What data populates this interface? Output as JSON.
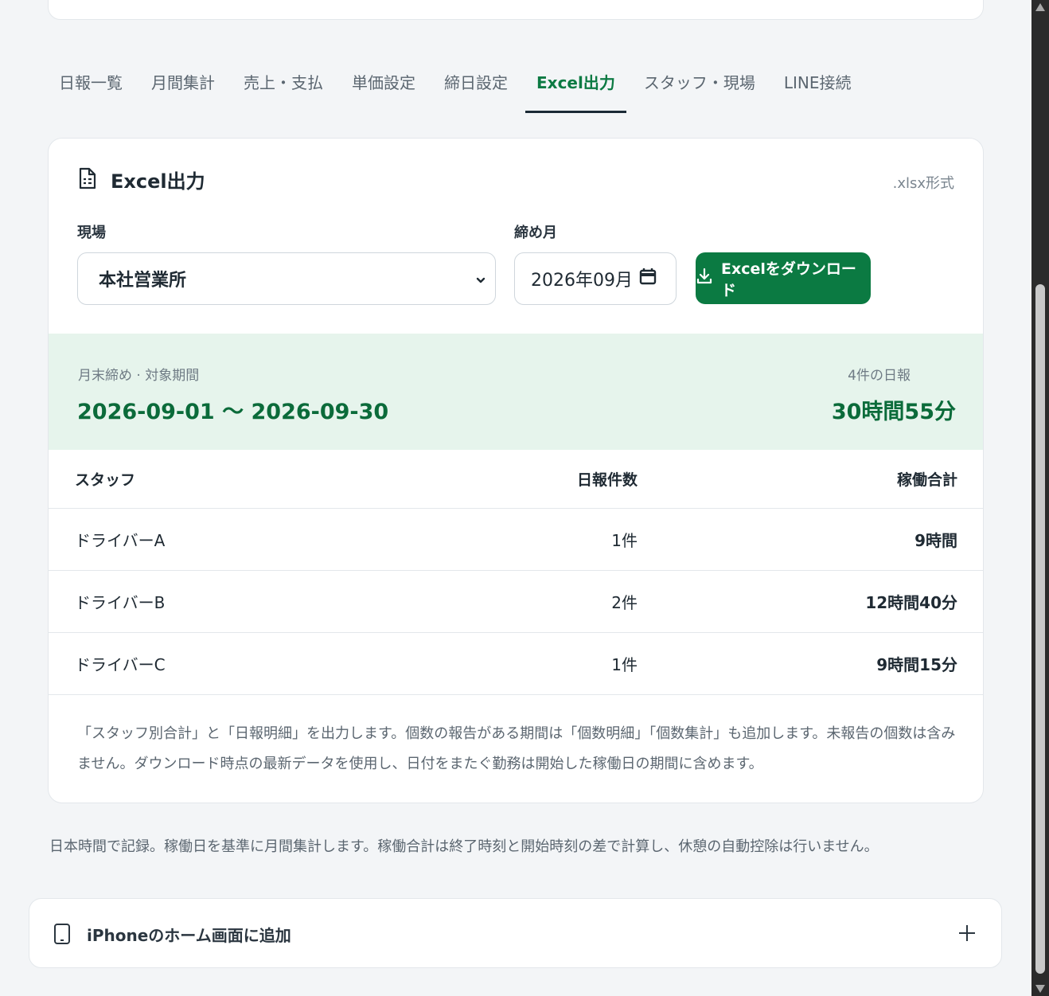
{
  "tabs": [
    {
      "label": "日報一覧"
    },
    {
      "label": "月間集計"
    },
    {
      "label": "売上・支払"
    },
    {
      "label": "単価設定"
    },
    {
      "label": "締日設定"
    },
    {
      "label": "Excel出力",
      "active": true
    },
    {
      "label": "スタッフ・現場"
    },
    {
      "label": "LINE接続"
    }
  ],
  "export_card": {
    "title": "Excel出力",
    "format": ".xlsx形式",
    "site_label": "現場",
    "site_value": "本社営業所",
    "month_label": "締め月",
    "month_value": "2026年09月",
    "download_label": "Excelをダウンロード",
    "icons": {
      "title": "document-icon",
      "select": "chevron-down-icon",
      "date": "calendar-icon",
      "download": "download-icon"
    }
  },
  "summary": {
    "period_label": "月末締め · 対象期間",
    "period_value": "2026-09-01 〜 2026-09-30",
    "count_label": "4件の日報",
    "total_value": "30時間55分"
  },
  "table": {
    "headers": [
      "スタッフ",
      "日報件数",
      "稼働合計"
    ],
    "rows": [
      [
        "ドライバーA",
        "1件",
        "9時間"
      ],
      [
        "ドライバーB",
        "2件",
        "12時間40分"
      ],
      [
        "ドライバーC",
        "1件",
        "9時間15分"
      ]
    ]
  },
  "note": "「スタッフ別合計」と「日報明細」を出力します。個数の報告がある期間は「個数明細」「個数集計」も追加します。未報告の個数は含みません。ダウンロード時点の最新データを使用し、日付をまたぐ勤務は開始した稼働日の期間に含めます。",
  "footnote": "日本時間で記録。稼働日を基準に月間集計します。稼働合計は終了時刻と開始時刻の差で計算し、休憩の自動控除は行いません。",
  "pwa": {
    "label": "iPhoneのホーム画面に追加",
    "icon": "phone-icon",
    "expand_icon": "plus-icon"
  },
  "colors": {
    "accent": "#0b7a42",
    "summary_bg": "#e6f4ec",
    "summary_text": "#0b6b3a"
  }
}
